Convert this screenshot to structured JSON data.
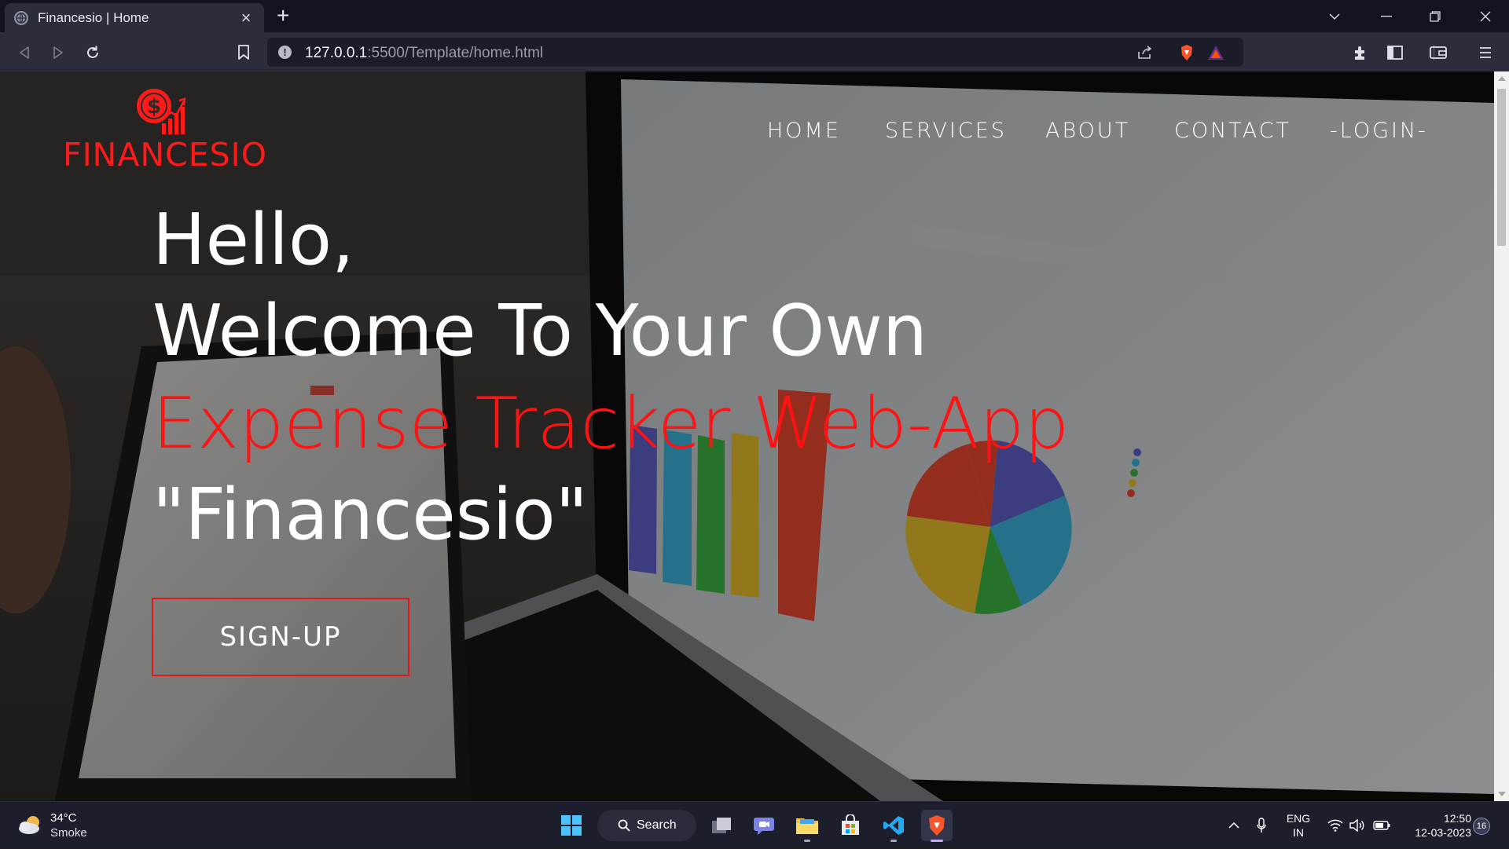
{
  "browser": {
    "tab_title": "Financesio | Home",
    "new_tab_label": "+",
    "url_host": "127.0.0.1",
    "url_path": ":5500/Template/home.html",
    "info_glyph": "!"
  },
  "site": {
    "brand": "FINANCESIO",
    "nav": {
      "home": "HOME",
      "services": "SERVICES",
      "about": "ABOUT",
      "contact": "CONTACT",
      "login": "-LOGIN-"
    },
    "hero": {
      "line1": "Hello,",
      "line2": "Welcome To Your Own",
      "line3": "Expense Tracker Web-App",
      "line4": "\"Financesio\""
    },
    "signup_label": "SIGN-UP",
    "accent_color": "#ff1212"
  },
  "taskbar": {
    "weather_temp": "34°C",
    "weather_condition": "Smoke",
    "search_label": "Search",
    "lang_line1": "ENG",
    "lang_line2": "IN",
    "time": "12:50",
    "date": "12-03-2023",
    "notification_count": "16"
  }
}
